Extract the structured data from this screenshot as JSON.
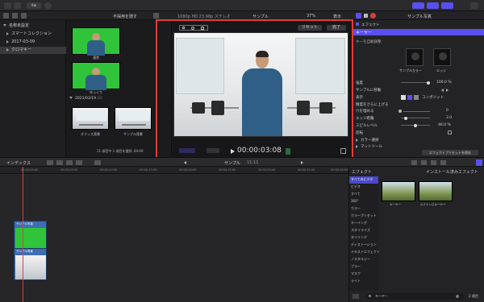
{
  "topbar": {
    "key_label": "0ю",
    "sample_photo_label": "サンプル写真"
  },
  "browser_header": {
    "filter_label": "不採用を隠す",
    "resolution_label": "1080p HD 23.98p ステレオ",
    "clip_label": "サンプル",
    "zoom_label": "37%",
    "display_label": "表示"
  },
  "library": {
    "items": [
      {
        "label": "名称未設定"
      },
      {
        "label": "スマートコレクション"
      },
      {
        "label": "2017-03-09"
      },
      {
        "label": "クロマキー"
      }
    ]
  },
  "browser": {
    "clips": [
      {
        "label": "通常"
      },
      {
        "label": "ゆっくり"
      },
      {
        "label": "オフィス背景"
      },
      {
        "label": "サンプル背景"
      }
    ],
    "date_group": "2021/03/19",
    "date_count": "(2)",
    "status": "11 項目中 1 項目を選択, 04:00"
  },
  "viewer": {
    "reset_label": "リセット",
    "done_label": "完了",
    "timecode": "00:00:03:08"
  },
  "inspector": {
    "effect_header": "エフェクト",
    "keyer_label": "キーヤー",
    "key_adjust": "キーを自動調整",
    "sample_color": "サンプルカラー",
    "edge": "エッジ",
    "strength_label": "強度",
    "strength_value": "100.0 %",
    "jump_label": "サンプルに移動",
    "view_label": "表示",
    "refine_label": "精度をさらに上げる",
    "composite_label": "コンポジット",
    "fill_holes_label": "穴を埋める",
    "fill_holes_value": "0",
    "edge_distance_label": "エッジ距離",
    "edge_distance_value": "3.0",
    "spill_level_label": "スピルレベル",
    "spill_level_value": "46.0 %",
    "invert_label": "反転",
    "color_selection": "カラー選択",
    "matte_tools": "マットツール",
    "save_preset": "エフェクトプリセットを保存"
  },
  "timeline_bar": {
    "index_label": "インデックス",
    "project_label": "サンプル",
    "project_duration": "11:11"
  },
  "ruler": {
    "ticks": [
      "00:00:00:00",
      "00:00:05:00",
      "00:00:10:00",
      "00:00:15:00",
      "00:00:20:00",
      "00:00:25:00",
      "00:00:30:00",
      "00:00:35:00",
      "00:00:40:00"
    ]
  },
  "timeline": {
    "clip1_label": "サンプル写真",
    "clip2_label": "サンプル背景"
  },
  "effects": {
    "tab_label": "エフェクト",
    "installed_label": "インストール済みエフェクト",
    "categories": [
      "すべてのビデオ",
      "ビデオ",
      "すべて",
      "360°",
      "カラー",
      "カラープリセット",
      "キーイング",
      "スタイライズ",
      "タイリング",
      "ディストーション",
      "テキストエフェクト",
      "ノスタルジー",
      "ブラー",
      "マスク",
      "ライト"
    ],
    "thumbs": [
      {
        "label": "キーヤー"
      },
      {
        "label": "ルミナンスキーヤー"
      }
    ],
    "search_placeholder": "キーヤー",
    "count_label": "2 項目"
  }
}
